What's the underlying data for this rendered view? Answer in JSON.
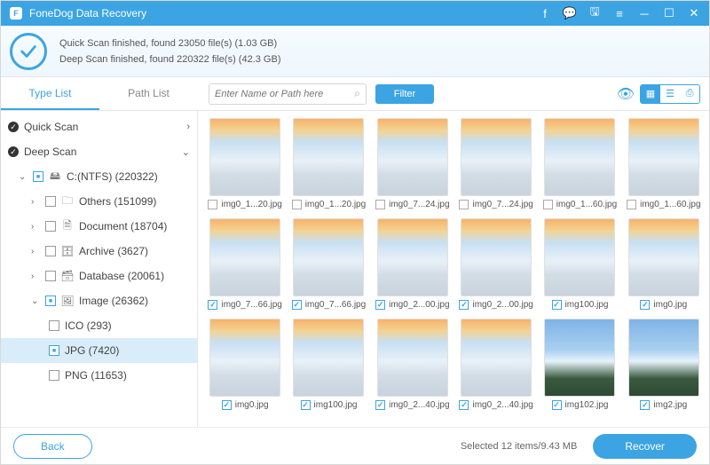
{
  "titlebar": {
    "title": "FoneDog Data Recovery"
  },
  "status": {
    "line1": "Quick Scan finished, found 23050 file(s) (1.03 GB)",
    "line2": "Deep Scan finished, found 220322 file(s) (42.3 GB)"
  },
  "tabs": {
    "type_list": "Type List",
    "path_list": "Path List"
  },
  "search": {
    "placeholder": "Enter Name or Path here"
  },
  "filter": {
    "label": "Filter"
  },
  "sidebar": {
    "quick_scan": "Quick Scan",
    "deep_scan": "Deep Scan",
    "drive": "C:(NTFS) (220322)",
    "others": "Others (151099)",
    "document": "Document (18704)",
    "archive": "Archive (3627)",
    "database": "Database (20061)",
    "image": "Image (26362)",
    "ico": "ICO (293)",
    "jpg": "JPG (7420)",
    "png": "PNG (11653)"
  },
  "files": [
    {
      "name": "img0_1...20.jpg",
      "checked": false,
      "variant": 0
    },
    {
      "name": "img0_1...20.jpg",
      "checked": false,
      "variant": 0
    },
    {
      "name": "img0_7...24.jpg",
      "checked": false,
      "variant": 0
    },
    {
      "name": "img0_7...24.jpg",
      "checked": false,
      "variant": 0
    },
    {
      "name": "img0_1...60.jpg",
      "checked": false,
      "variant": 0
    },
    {
      "name": "img0_1...60.jpg",
      "checked": false,
      "variant": 0
    },
    {
      "name": "img0_7...66.jpg",
      "checked": true,
      "variant": 0
    },
    {
      "name": "img0_7...66.jpg",
      "checked": true,
      "variant": 0
    },
    {
      "name": "img0_2...00.jpg",
      "checked": true,
      "variant": 0
    },
    {
      "name": "img0_2...00.jpg",
      "checked": true,
      "variant": 0
    },
    {
      "name": "img100.jpg",
      "checked": true,
      "variant": 0
    },
    {
      "name": "img0.jpg",
      "checked": true,
      "variant": 0
    },
    {
      "name": "img0.jpg",
      "checked": true,
      "variant": 0
    },
    {
      "name": "img100.jpg",
      "checked": true,
      "variant": 0
    },
    {
      "name": "img0_2...40.jpg",
      "checked": true,
      "variant": 0
    },
    {
      "name": "img0_2...40.jpg",
      "checked": true,
      "variant": 0
    },
    {
      "name": "img102.jpg",
      "checked": true,
      "variant": 1
    },
    {
      "name": "img2.jpg",
      "checked": true,
      "variant": 1
    }
  ],
  "footer": {
    "back": "Back",
    "selected": "Selected 12 items/9.43 MB",
    "recover": "Recover"
  }
}
